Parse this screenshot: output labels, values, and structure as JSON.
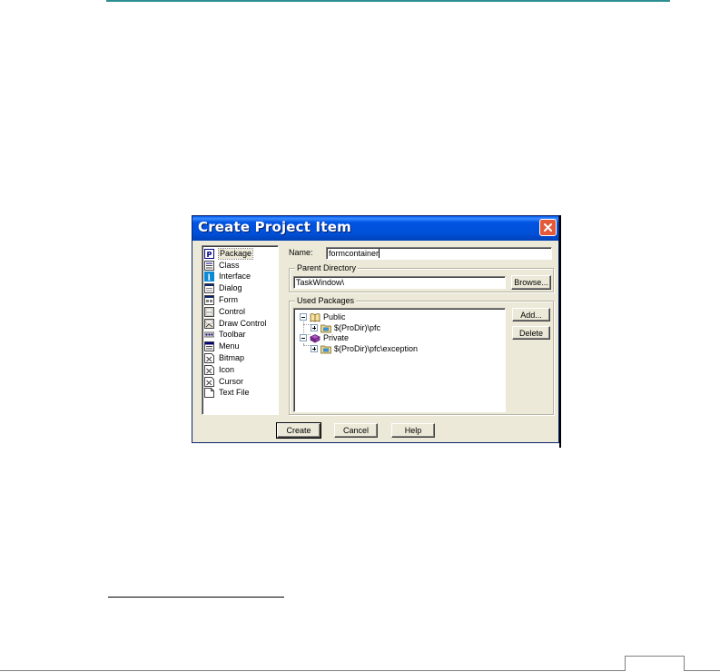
{
  "dialog": {
    "title": "Create Project Item"
  },
  "item_types": [
    {
      "label": "Package",
      "icon": "package-icon",
      "selected": true
    },
    {
      "label": "Class",
      "icon": "class-icon"
    },
    {
      "label": "Interface",
      "icon": "interface-icon"
    },
    {
      "label": "Dialog",
      "icon": "dialog-icon"
    },
    {
      "label": "Form",
      "icon": "form-icon"
    },
    {
      "label": "Control",
      "icon": "control-icon"
    },
    {
      "label": "Draw Control",
      "icon": "draw-control-icon"
    },
    {
      "label": "Toolbar",
      "icon": "toolbar-icon"
    },
    {
      "label": "Menu",
      "icon": "menu-icon"
    },
    {
      "label": "Bitmap",
      "icon": "bitmap-icon"
    },
    {
      "label": "Icon",
      "icon": "icon-file-icon"
    },
    {
      "label": "Cursor",
      "icon": "cursor-icon"
    },
    {
      "label": "Text File",
      "icon": "text-file-icon"
    }
  ],
  "name_field": {
    "label": "Name:",
    "value": "formcontainer"
  },
  "parent_directory": {
    "legend": "Parent Directory",
    "value": "TaskWindow\\",
    "browse_label": "Browse..."
  },
  "used_packages": {
    "legend": "Used Packages",
    "tree": [
      {
        "label": "Public",
        "icon": "public-folder-icon",
        "children": [
          {
            "label": "$(ProDir)\\pfc",
            "icon": "package-folder-icon"
          }
        ]
      },
      {
        "label": "Private",
        "icon": "private-folder-icon",
        "children": [
          {
            "label": "$(ProDir)\\pfc\\exception",
            "icon": "package-folder-icon"
          }
        ]
      }
    ],
    "add_label": "Add...",
    "delete_label": "Delete"
  },
  "buttons": {
    "create": "Create",
    "cancel": "Cancel",
    "help": "Help"
  },
  "colors": {
    "titlebar": "#0054e3",
    "dialog_bg": "#ece9d8",
    "close_button": "#e35a3a",
    "page_top_rule": "#2e8f93"
  }
}
